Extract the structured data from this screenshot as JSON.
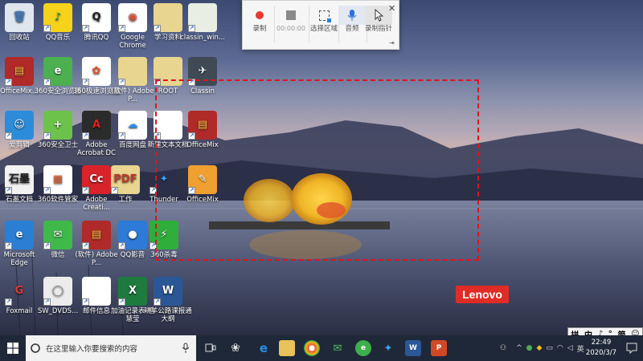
{
  "desktop": {
    "icons": [
      {
        "label": "回收站",
        "glyph": "🗑",
        "bg": "#dfe6ee",
        "color": "#4a7bb7"
      },
      {
        "label": "QQ音乐",
        "glyph": "♪",
        "bg": "#f6d21b",
        "color": "#1b8a4f"
      },
      {
        "label": "腾讯QQ",
        "glyph": "Q",
        "bg": "#ffffff",
        "color": "#222"
      },
      {
        "label": "Google Chrome",
        "glyph": "◉",
        "bg": "#ffffff",
        "color": "#dd4b39"
      },
      {
        "label": "学习资料",
        "glyph": "",
        "bg": "#e8d58f",
        "color": "#b08a2a"
      },
      {
        "label": "classin_win...",
        "glyph": "",
        "bg": "#e8eee3",
        "color": "#6c9a5a"
      },
      {
        "label": "OfficeMix...",
        "glyph": "▤",
        "bg": "#b02a2a",
        "color": "#f5c542"
      },
      {
        "label": "360安全浏览器",
        "glyph": "e",
        "bg": "#4caf50",
        "color": "#fff"
      },
      {
        "label": "360极速浏览器",
        "glyph": "✿",
        "bg": "#ffffff",
        "color": "#e6542b"
      },
      {
        "label": "(软件) Adobe P...",
        "glyph": "",
        "bg": "#e8d58f",
        "color": "#b08a2a"
      },
      {
        "label": "ROOT",
        "glyph": "",
        "bg": "#e8d58f",
        "color": "#b08a2a"
      },
      {
        "label": "Classin",
        "glyph": "✈",
        "bg": "#3f4a55",
        "color": "#fff"
      },
      {
        "label": "爱剪辑",
        "glyph": "☺",
        "bg": "#2c8cd9",
        "color": "#fff"
      },
      {
        "label": "360安全卫士",
        "glyph": "+",
        "bg": "#6cc24a",
        "color": "#fff"
      },
      {
        "label": "Adobe Acrobat DC",
        "glyph": "A",
        "bg": "#2b2b2b",
        "color": "#e0201b"
      },
      {
        "label": "百度网盘",
        "glyph": "☁",
        "bg": "#ffffff",
        "color": "#2e8cf0"
      },
      {
        "label": "新建文本文档",
        "glyph": "",
        "bg": "#ffffff",
        "color": "#999"
      },
      {
        "label": "OfficeMix",
        "glyph": "▤",
        "bg": "#b02a2a",
        "color": "#f5c542"
      },
      {
        "label": "石墨文档",
        "glyph": "石墨",
        "bg": "#f2f2f2",
        "color": "#222"
      },
      {
        "label": "360软件管家",
        "glyph": "▦",
        "bg": "#ffffff",
        "color": "#e25a2a"
      },
      {
        "label": "Adobe Creati...",
        "glyph": "Cc",
        "bg": "#d8232a",
        "color": "#fff"
      },
      {
        "label": "工作",
        "glyph": "PDF",
        "bg": "#e8d58f",
        "color": "#c0392b"
      },
      {
        "label": "Thunder",
        "glyph": "✦",
        "bg": "transparent",
        "color": "#3aa0f0"
      },
      {
        "label": "OfficeMix",
        "glyph": "✎",
        "bg": "#f0a030",
        "color": "#fff"
      },
      {
        "label": "Microsoft Edge",
        "glyph": "e",
        "bg": "#2a7fd4",
        "color": "#fff"
      },
      {
        "label": "微信",
        "glyph": "✉",
        "bg": "#3fb94a",
        "color": "#fff"
      },
      {
        "label": "(软件) Adobe P...",
        "glyph": "▤",
        "bg": "#b02a2a",
        "color": "#f5c542"
      },
      {
        "label": "QQ影音",
        "glyph": "●",
        "bg": "#2d7bd6",
        "color": "#fff"
      },
      {
        "label": "360杀毒",
        "glyph": "⚡",
        "bg": "#2fae3b",
        "color": "#fff"
      },
      {
        "label": "Foxmail",
        "glyph": "G",
        "bg": "transparent",
        "color": "#e03a2f"
      },
      {
        "label": "SW_DVDS...",
        "glyph": "◯",
        "bg": "#ececec",
        "color": "#888"
      },
      {
        "label": "邮件信息",
        "glyph": "",
        "bg": "#ffffff",
        "color": "#999"
      },
      {
        "label": "加油记录表-毛慧莹",
        "glyph": "X",
        "bg": "#1f7a3f",
        "color": "#fff"
      },
      {
        "label": "晓羊公路课报通大纲",
        "glyph": "W",
        "bg": "#2b5797",
        "color": "#fff"
      }
    ]
  },
  "recorder": {
    "record_label": "录制",
    "timer": "00:00:00",
    "select_area_label": "选择区域",
    "audio_label": "音频",
    "pointer_label": "录制指针",
    "close_glyph": "✕",
    "pin_glyph": "⇥"
  },
  "wallpaper": {
    "brand": "Lenovo"
  },
  "taskbar": {
    "search_placeholder": "在这里输入你要搜索的内容",
    "time": "22:49",
    "date": "2020/3/7",
    "ime": [
      "拼",
      "中",
      "♪",
      "°",
      "简",
      "☺"
    ],
    "tray_input": "英"
  },
  "colors": {
    "selection": "#e0141e",
    "taskbar": "#1f2838",
    "record_dot": "#e53935",
    "lenovo": "#e02c26"
  }
}
